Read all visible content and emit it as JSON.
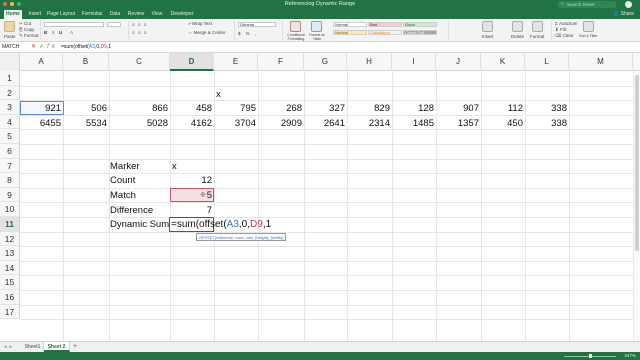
{
  "window": {
    "title": "Referencing Dynamic Range",
    "search_placeholder": "Search Sheet"
  },
  "tabs": [
    "Home",
    "Insert",
    "Page Layout",
    "Formulas",
    "Data",
    "Review",
    "View",
    "Developer"
  ],
  "active_tab": "Home",
  "share_label": "Share",
  "ribbon": {
    "paste": "Paste",
    "cut": "Cut",
    "copy": "Copy",
    "format": "Format",
    "wrap_text": "Wrap Text",
    "merge_center": "Merge & Center",
    "number_format": "General",
    "conditional_formatting": "Conditional Formatting",
    "format_as_table": "Format as Table",
    "styles": [
      "Normal",
      "Bad",
      "Good",
      "Neutral",
      "Calculation",
      "Check Cell"
    ],
    "insert": "Insert",
    "delete": "Delete",
    "format_cells": "Format",
    "autosum": "AutoSum",
    "fill": "Fill",
    "clear": "Clear",
    "sort_filter": "Sort & Filter"
  },
  "formula_bar": {
    "name_box": "MATCH",
    "cancel_icon": "✕",
    "enter_icon": "✓",
    "fx_label": "fx",
    "formula_prefix": "=sum(offset(",
    "formula_ref1": "A3",
    "formula_mid": ",0,",
    "formula_ref2": "D9",
    "formula_suffix": ",1"
  },
  "columns": [
    "A",
    "B",
    "C",
    "D",
    "E",
    "F",
    "G",
    "H",
    "I",
    "J",
    "K",
    "L",
    "M"
  ],
  "selected_column": "D",
  "rows": [
    "1",
    "2",
    "3",
    "4",
    "5",
    "6",
    "7",
    "8",
    "9",
    "10",
    "11",
    "12",
    "13",
    "14",
    "15",
    "16",
    "17"
  ],
  "selected_row": "11",
  "cells": {
    "E2": "x",
    "row3": [
      "921",
      "506",
      "866",
      "458",
      "795",
      "268",
      "327",
      "829",
      "128",
      "907",
      "112",
      "338"
    ],
    "row4": [
      "6455",
      "5534",
      "5028",
      "4162",
      "3704",
      "2909",
      "2641",
      "2314",
      "1485",
      "1357",
      "450",
      "338"
    ],
    "labels": {
      "c7": "Marker",
      "c8": "Count",
      "c9": "Match",
      "c10": "Difference",
      "c11": "Dynamic Sum"
    },
    "values": {
      "d7": "x",
      "d8": "12",
      "d9": "5",
      "d10": "7"
    },
    "d11_edit": {
      "prefix": "=sum(offset(",
      "ref1": "A3",
      "mid": ",0,",
      "ref2": "D9",
      "suffix": ",1"
    }
  },
  "tooltip": "OFFSET(reference, rows, cols, [height], [width])",
  "sheets": [
    "Sheet1",
    "Sheet 2"
  ],
  "active_sheet": "Sheet 2",
  "zoom": "247%",
  "colors": {
    "excel_green": "#217346",
    "ref_blue": "#3a6fd8",
    "ref_red": "#c0394f",
    "match_fill": "#f7dfe3"
  }
}
